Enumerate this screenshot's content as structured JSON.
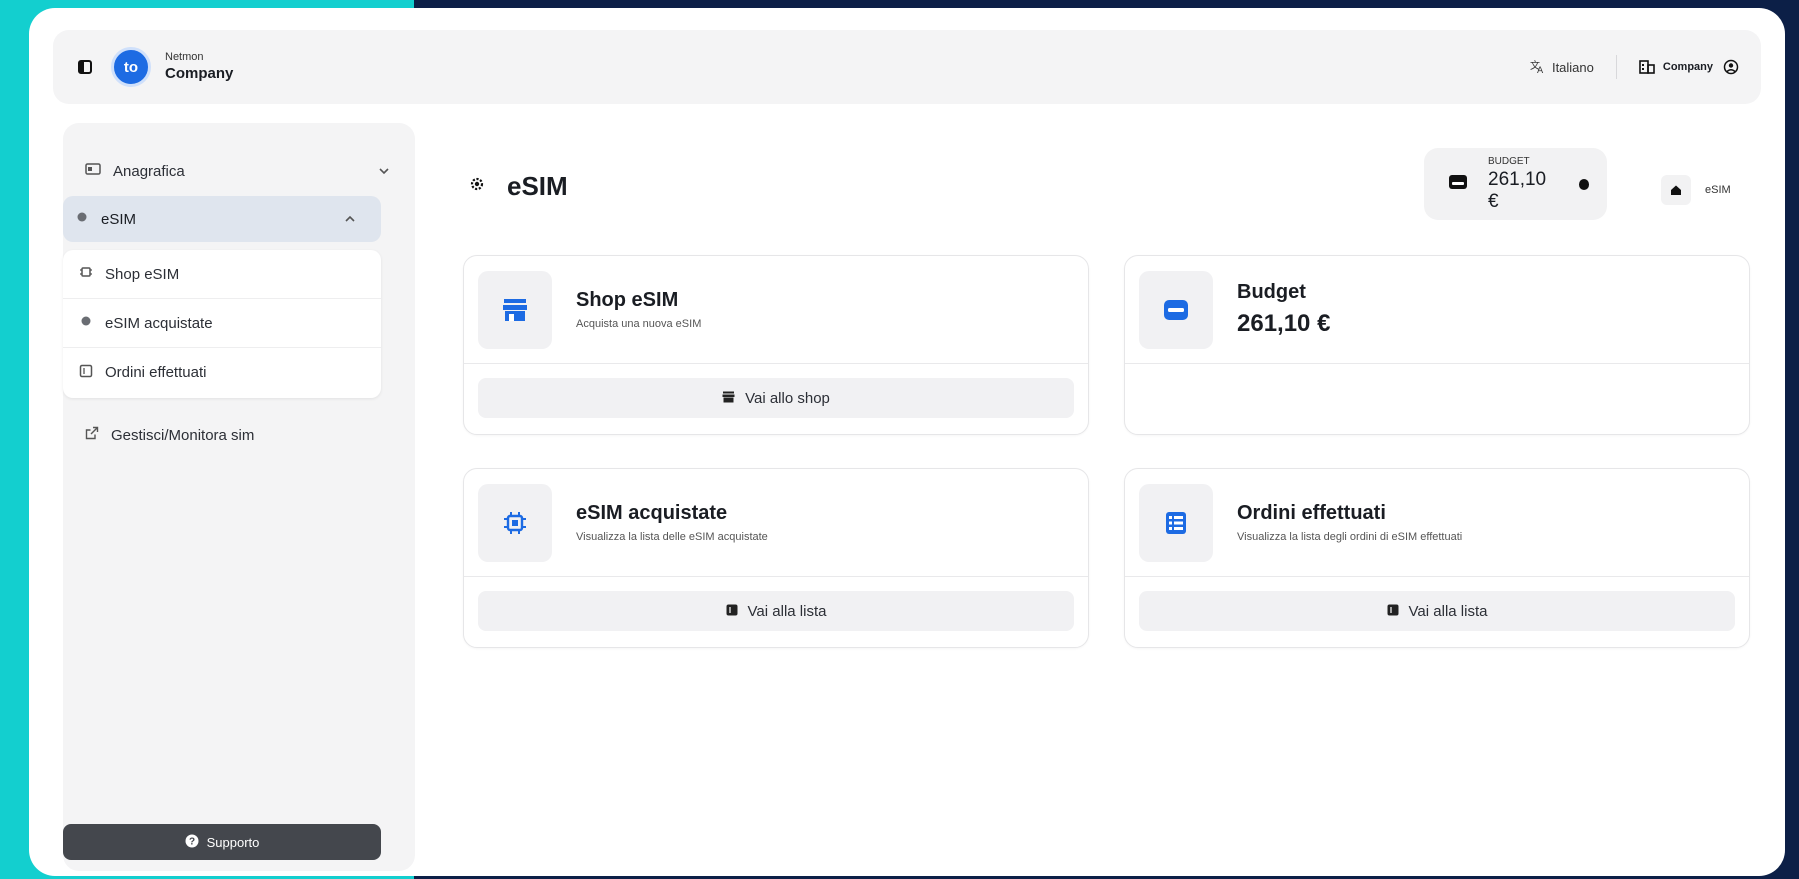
{
  "header": {
    "brand_small": "Netmon",
    "brand_name": "Company",
    "logo_text": "to",
    "language": "Italiano",
    "company": "Company"
  },
  "sidebar": {
    "items": [
      {
        "label": "Anagrafica",
        "icon": "id-card-icon"
      },
      {
        "label": "eSIM",
        "icon": "dot-icon"
      },
      {
        "label": "Gestisci/Monitora sim",
        "icon": "external-link-icon"
      }
    ],
    "subitems": [
      {
        "label": "Shop eSIM",
        "icon": "chip-icon"
      },
      {
        "label": "eSIM acquistate",
        "icon": "dot-icon"
      },
      {
        "label": "Ordini effettuati",
        "icon": "list-icon"
      }
    ],
    "support_label": "Supporto"
  },
  "main": {
    "title": "eSIM",
    "budget_widget": {
      "label": "BUDGET",
      "value": "261,10 €"
    },
    "breadcrumb": "eSIM",
    "cards": [
      {
        "title": "Shop eSIM",
        "subtitle": "Acquista una nuova eSIM",
        "button": "Vai allo shop"
      },
      {
        "title": "Budget",
        "value": "261,10 €"
      },
      {
        "title": "eSIM acquistate",
        "subtitle": "Visualizza la lista delle eSIM acquistate",
        "button": "Vai alla lista"
      },
      {
        "title": "Ordini effettuati",
        "subtitle": "Visualizza la lista degli ordini di eSIM effettuati",
        "button": "Vai alla lista"
      }
    ]
  },
  "colors": {
    "accent": "#1d6be3",
    "background_dark": "#0c1f47",
    "background_cyan": "#13cfcf"
  }
}
